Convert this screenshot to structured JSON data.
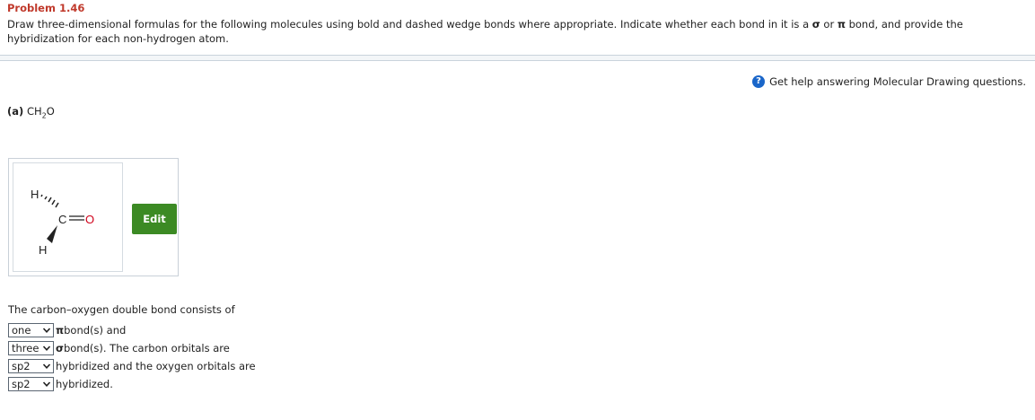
{
  "problem": {
    "title": "Problem 1.46",
    "instructions_part1": "Draw three-dimensional formulas for the following molecules using bold and dashed wedge bonds where appropriate. Indicate whether each bond in it is a ",
    "sigma": "σ",
    "instructions_or": " or ",
    "pi": "π",
    "instructions_part2": " bond, and provide the hybridization for each non-hydrogen atom."
  },
  "help": {
    "icon": "?",
    "text": "Get help answering Molecular Drawing questions."
  },
  "part_a": {
    "label": "(a)",
    "formula_prefix": "CH",
    "formula_sub": "2",
    "formula_suffix": "O"
  },
  "drawing": {
    "atom_h_top": "H",
    "atom_c": "C",
    "atom_o": "O",
    "atom_h_bottom": "H",
    "edit_label": "Edit",
    "oxygen_color": "#d0021b",
    "bond_color": "#222222"
  },
  "question": {
    "intro": "The carbon–oxygen double bond consists of",
    "rows": [
      {
        "select": "one",
        "greek": "π",
        "text": " bond(s) and"
      },
      {
        "select": "three",
        "greek": "σ",
        "text": " bond(s). The carbon orbitals are"
      },
      {
        "select": "sp2",
        "greek": "",
        "text": "hybridized and the oxygen orbitals are"
      },
      {
        "select": "sp2",
        "greek": "",
        "text": "hybridized."
      }
    ]
  }
}
